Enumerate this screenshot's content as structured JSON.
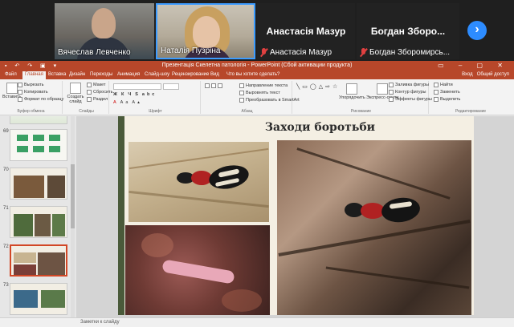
{
  "participants": [
    {
      "name": "Вячеслав Левченко",
      "video": true
    },
    {
      "name": "Наталія Пузріна",
      "video": true
    },
    {
      "name": "Анастасія Мазур",
      "label": "Анастасія Мазур",
      "video": false,
      "muted": true
    },
    {
      "name": "Богдан Зборомирсь...",
      "label": "Богдан Зборо...",
      "video": false,
      "muted": true
    }
  ],
  "ppt": {
    "window_title": "Презентація Скелетна патологія - PowerPoint (Сбой активации продукта)",
    "tabs": [
      "Файл",
      "Главная",
      "Вставка",
      "Дизайн",
      "Переходы",
      "Анимация",
      "Слайд-шоу",
      "Рецензирование",
      "Вид",
      "Что вы хотите сделать?"
    ],
    "active_tab": "Главная",
    "right_links": [
      "Вход",
      "Общий доступ"
    ],
    "ribbon": {
      "clipboard": {
        "paste": "Вставить",
        "cut": "Вырезать",
        "copy": "Копировать",
        "format": "Формат по образцу",
        "label": "Буфер обмена"
      },
      "slides": {
        "new": "Создать слайд",
        "layout": "Макет",
        "reset": "Сбросить",
        "section": "Раздел",
        "label": "Слайды"
      },
      "font_label": "Шрифт",
      "paragraph": {
        "text_dir": "Направление текста",
        "align": "Выровнять текст",
        "smartart": "Преобразовать в SmartArt",
        "label": "Абзац"
      },
      "drawing": {
        "arrange": "Упорядочить",
        "styles": "Экспресс-стили",
        "fill": "Заливка фигуры",
        "outline": "Контур фигуры",
        "effects": "Эффекты фигуры",
        "label": "Рисование"
      },
      "editing": {
        "find": "Найти",
        "replace": "Заменить",
        "select": "Выделить",
        "label": "Редактирование"
      }
    },
    "thumbnails": [
      {
        "num": "69",
        "selected": false
      },
      {
        "num": "70",
        "selected": false
      },
      {
        "num": "71",
        "selected": false
      },
      {
        "num": "72",
        "selected": true
      },
      {
        "num": "73",
        "selected": false
      }
    ],
    "slide": {
      "title": "Заходи боротьби"
    },
    "status": {
      "notes": "Заметки к слайду"
    }
  },
  "colors": {
    "ppt_accent": "#b7472a",
    "zoom_blue": "#2d8cff",
    "mute_red": "#e04040"
  }
}
